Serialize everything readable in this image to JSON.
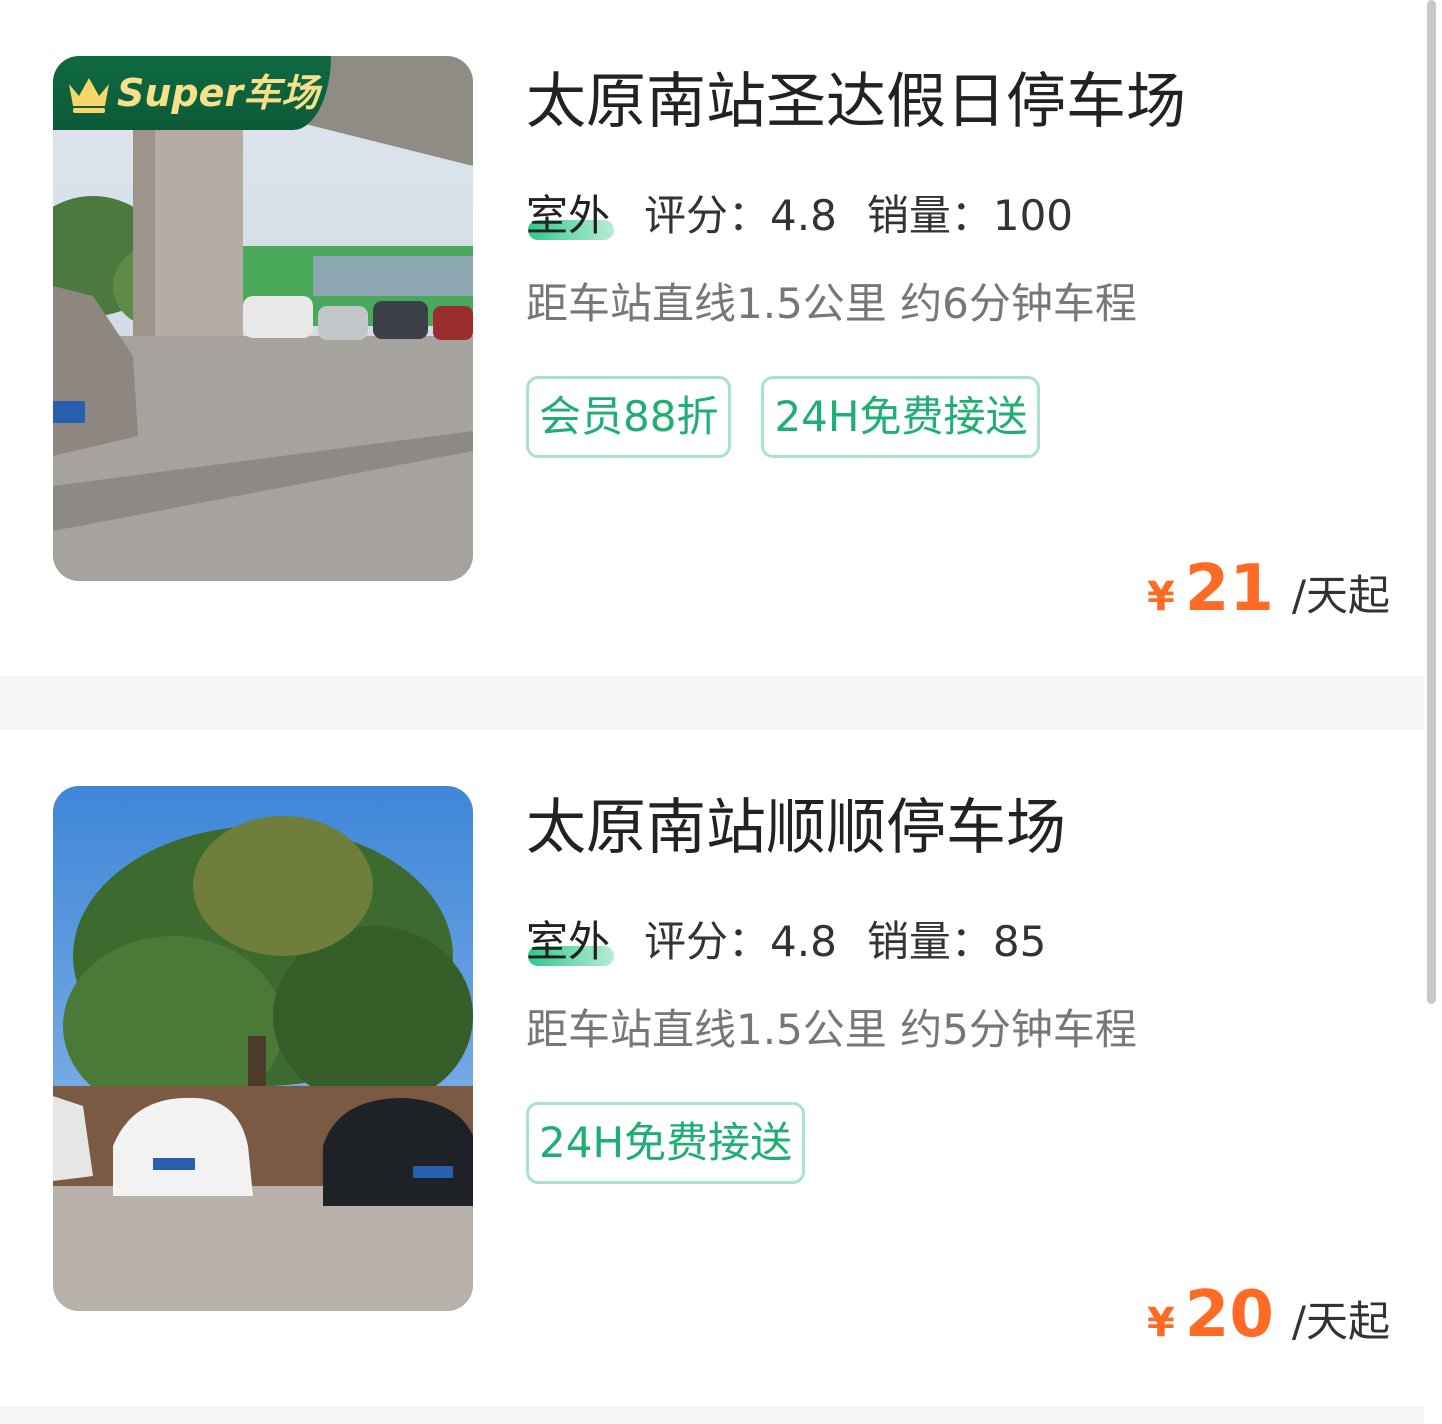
{
  "listings": [
    {
      "badge": "Super车场",
      "title": "太原南站圣达假日停车场",
      "type": "室外",
      "rating_label": "评分：",
      "rating": "4.8",
      "sales_label": "销量：",
      "sales": "100",
      "distance": "距车站直线1.5公里 约6分钟车程",
      "tags": [
        "会员88折",
        "24H免费接送"
      ],
      "currency": "¥",
      "price": "21",
      "price_unit": "/天起"
    },
    {
      "title": "太原南站顺顺停车场",
      "type": "室外",
      "rating_label": "评分：",
      "rating": "4.8",
      "sales_label": "销量：",
      "sales": "85",
      "distance": "距车站直线1.5公里 约5分钟车程",
      "tags": [
        "24H免费接送"
      ],
      "currency": "¥",
      "price": "20",
      "price_unit": "/天起"
    }
  ],
  "colors": {
    "accent_green": "#1fae73",
    "price_orange": "#ff6a24",
    "badge_green": "#0f6a43"
  }
}
